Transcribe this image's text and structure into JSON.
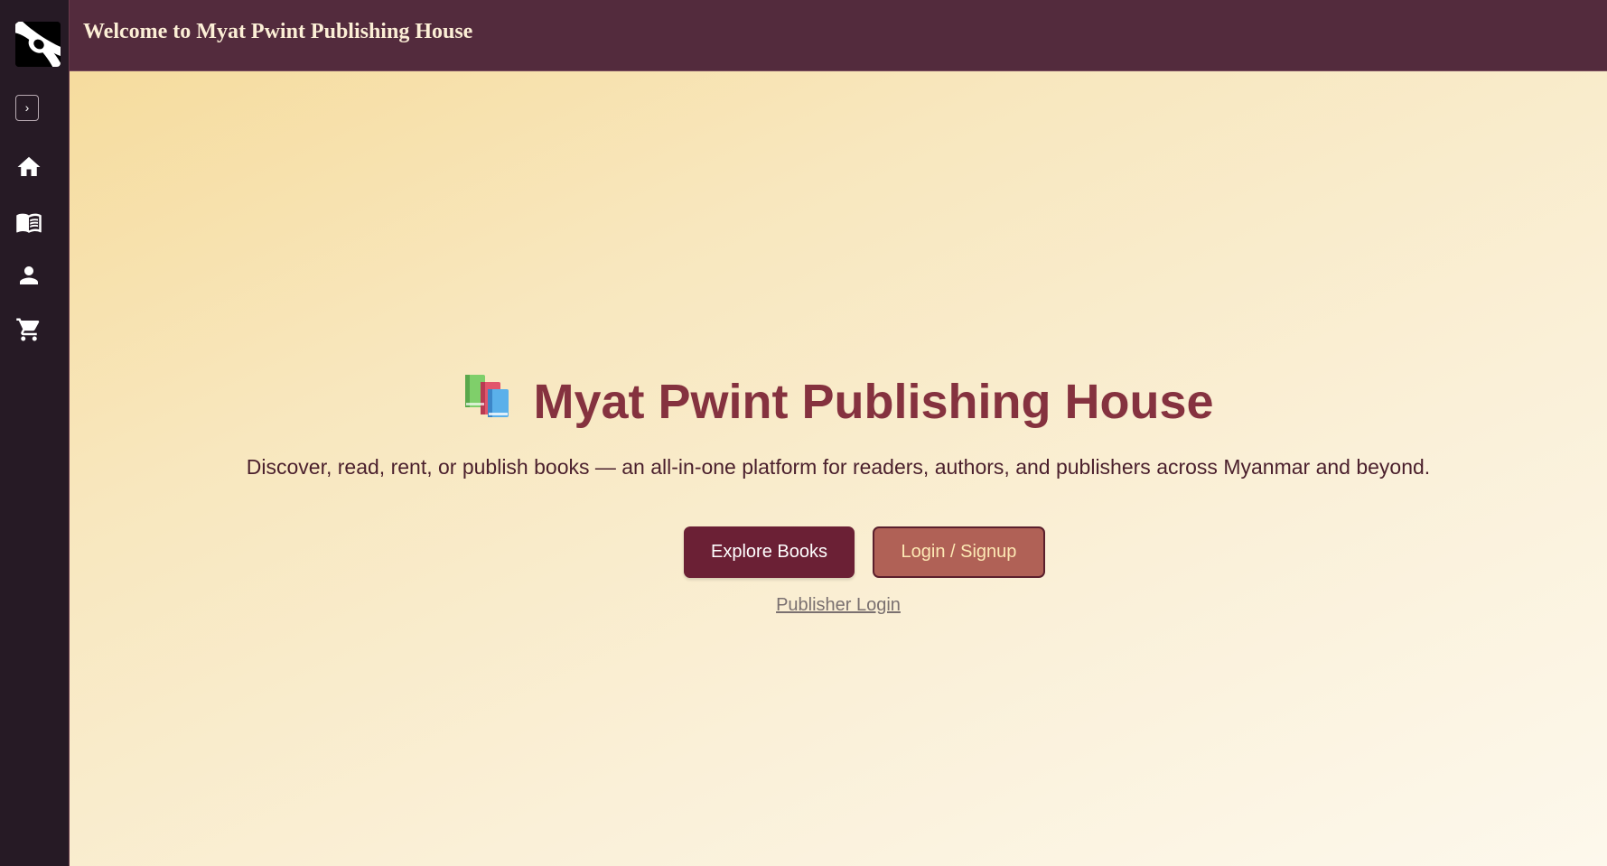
{
  "header": {
    "title": "Welcome to Myat Pwint Publishing House"
  },
  "sidebar": {
    "toggle_label": "›",
    "items": [
      {
        "icon": "home-icon"
      },
      {
        "icon": "book-icon"
      },
      {
        "icon": "user-icon"
      },
      {
        "icon": "cart-icon"
      }
    ]
  },
  "hero": {
    "icon": "books-icon",
    "title": "Myat Pwint Publishing House",
    "subtitle": "Discover, read, rent, or publish books — an all-in-one platform for readers, authors, and publishers across Myanmar and beyond.",
    "explore_label": "Explore Books",
    "login_label": "Login / Signup",
    "publisher_login_label": "Publisher Login"
  },
  "colors": {
    "sidebar_bg": "#261a25",
    "topbar_bg": "#532b3d",
    "accent": "#85323f",
    "explore_bg": "#6b2035",
    "login_bg": "#b06156",
    "login_text": "#fde9b4"
  }
}
